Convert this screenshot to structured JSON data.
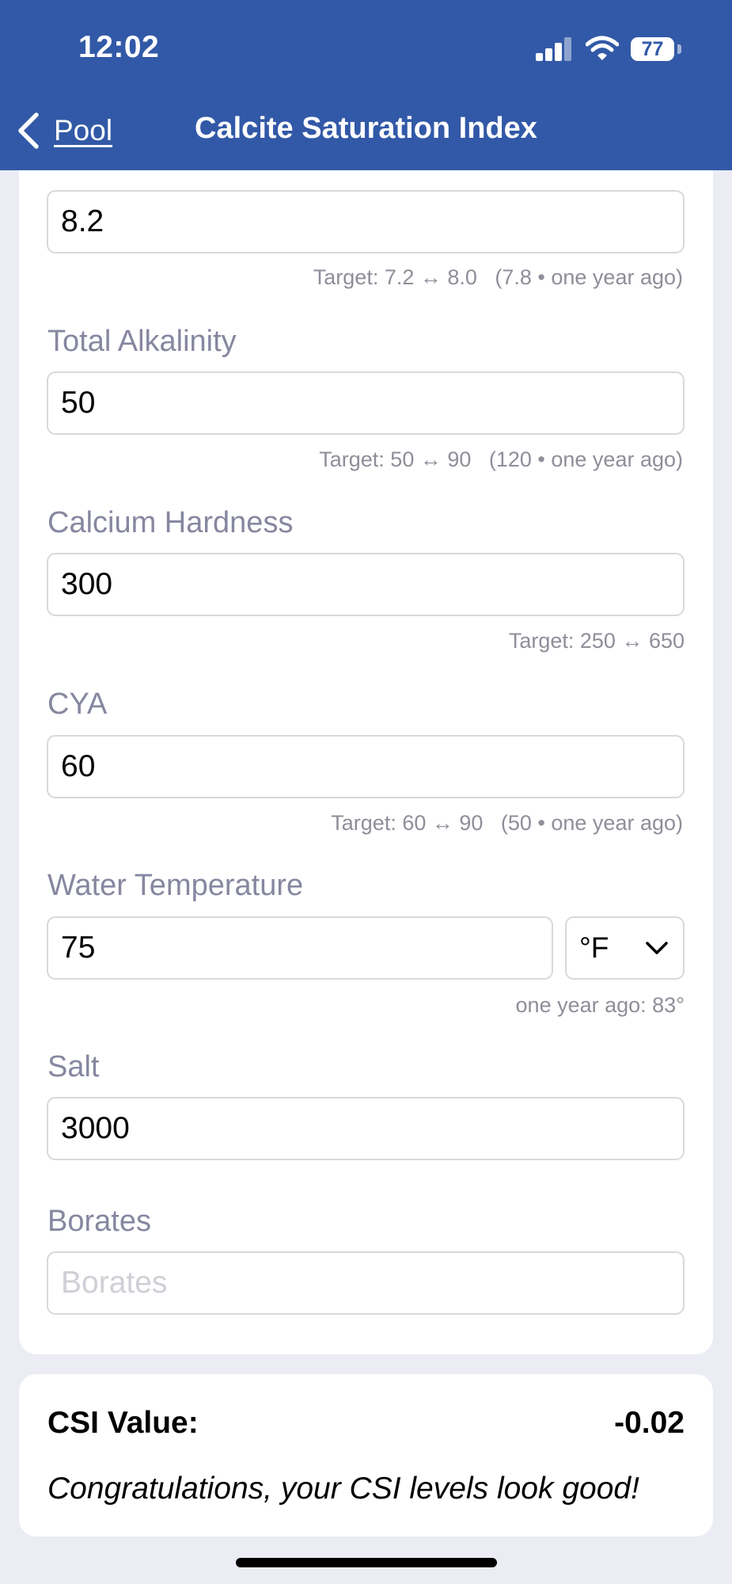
{
  "status_bar": {
    "time": "12:02",
    "battery": "77"
  },
  "nav": {
    "back_label": "Pool",
    "title": "Calcite Saturation Index"
  },
  "form": {
    "ph": {
      "value": "8.2",
      "hint": "Target: 7.2 ↔ 8.0   (7.8 • one year ago)"
    },
    "total_alkalinity": {
      "label": "Total Alkalinity",
      "value": "50",
      "hint": "Target: 50 ↔ 90   (120 • one year ago)"
    },
    "calcium_hardness": {
      "label": "Calcium Hardness",
      "value": "300",
      "hint": "Target: 250 ↔ 650"
    },
    "cya": {
      "label": "CYA",
      "value": "60",
      "hint": "Target: 60 ↔ 90   (50 • one year ago)"
    },
    "water_temperature": {
      "label": "Water Temperature",
      "value": "75",
      "unit": "°F",
      "hint": "one year ago: 83°"
    },
    "salt": {
      "label": "Salt",
      "value": "3000"
    },
    "borates": {
      "label": "Borates",
      "placeholder": "Borates"
    }
  },
  "result": {
    "csi_label": "CSI Value:",
    "csi_value": "-0.02",
    "message": "Congratulations, your CSI levels look good!"
  },
  "colors": {
    "header": "#3259a7",
    "background": "#ebecf4",
    "label": "#8687a0"
  }
}
